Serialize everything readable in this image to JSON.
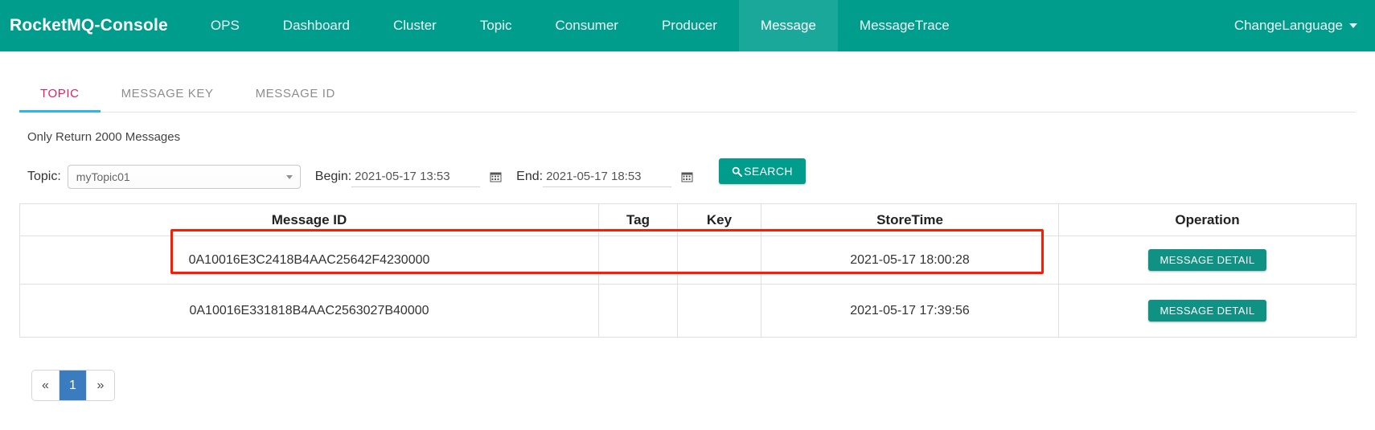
{
  "navbar": {
    "brand": "RocketMQ-Console",
    "items": [
      {
        "label": "OPS",
        "active": false
      },
      {
        "label": "Dashboard",
        "active": false
      },
      {
        "label": "Cluster",
        "active": false
      },
      {
        "label": "Topic",
        "active": false
      },
      {
        "label": "Consumer",
        "active": false
      },
      {
        "label": "Producer",
        "active": false
      },
      {
        "label": "Message",
        "active": true
      },
      {
        "label": "MessageTrace",
        "active": false
      }
    ],
    "language": "ChangeLanguage",
    "bg_color": "#009c8c",
    "active_bg_color": "#1aa89a"
  },
  "tabs": [
    {
      "label": "TOPIC",
      "active": true
    },
    {
      "label": "MESSAGE KEY",
      "active": false
    },
    {
      "label": "MESSAGE ID",
      "active": false
    }
  ],
  "tab_active_color": "#e91e5f",
  "tab_underline_color": "#29b6f6",
  "note": "Only Return 2000 Messages",
  "filters": {
    "topic_label": "Topic:",
    "topic_value": "myTopic01",
    "begin_label": "Begin:",
    "begin_value": "2021-05-17 13:53",
    "end_label": "End:",
    "end_value": "2021-05-17 18:53",
    "search_label": "SEARCH"
  },
  "table": {
    "headers": [
      "Message ID",
      "Tag",
      "Key",
      "StoreTime",
      "Operation"
    ],
    "rows": [
      {
        "message_id": "0A10016E3C2418B4AAC25642F4230000",
        "tag": "",
        "key": "",
        "store_time": "2021-05-17 18:00:28",
        "operation": "MESSAGE DETAIL",
        "highlighted": true
      },
      {
        "message_id": "0A10016E331818B4AAC2563027B40000",
        "tag": "",
        "key": "",
        "store_time": "2021-05-17 17:39:56",
        "operation": "MESSAGE DETAIL",
        "highlighted": false
      }
    ]
  },
  "annotation_color": "#ff1a00",
  "pagination": {
    "prev": "«",
    "pages": [
      "1"
    ],
    "next": "»",
    "active_page": "1",
    "active_color": "#3a7cbe"
  }
}
